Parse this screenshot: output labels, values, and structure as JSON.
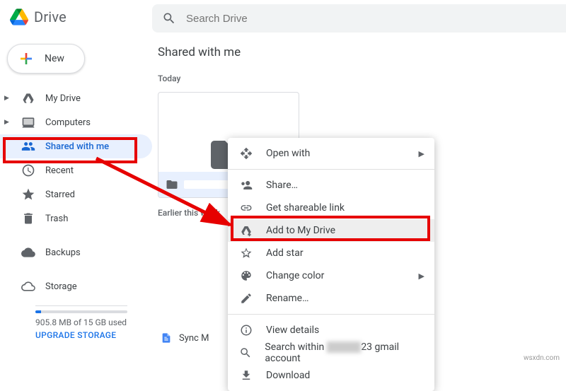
{
  "app_title": "Drive",
  "search": {
    "placeholder": "Search Drive"
  },
  "new_button": "New",
  "sidebar": {
    "items": [
      {
        "label": "My Drive",
        "icon": "drive"
      },
      {
        "label": "Computers",
        "icon": "computer"
      },
      {
        "label": "Shared with me",
        "icon": "people"
      },
      {
        "label": "Recent",
        "icon": "clock"
      },
      {
        "label": "Starred",
        "icon": "star"
      },
      {
        "label": "Trash",
        "icon": "trash"
      },
      {
        "label": "Backups",
        "icon": "cloud-filled"
      },
      {
        "label": "Storage",
        "icon": "cloud-outline"
      }
    ],
    "storage_text": "905.8 MB of 15 GB used",
    "upgrade_text": "UPGRADE STORAGE"
  },
  "main": {
    "title": "Shared with me",
    "sections": {
      "today": "Today",
      "earlier": "Earlier this week"
    },
    "file_row_label": "Sync M"
  },
  "context_menu": {
    "open_with": "Open with",
    "share": "Share…",
    "get_link": "Get shareable link",
    "add_drive": "Add to My Drive",
    "add_star": "Add star",
    "change_color": "Change color",
    "rename": "Rename…",
    "view_details": "View details",
    "search_within_prefix": "Search within ",
    "search_within_suffix": "23 gmail account",
    "download": "Download"
  },
  "watermark": "wsxdn.com"
}
